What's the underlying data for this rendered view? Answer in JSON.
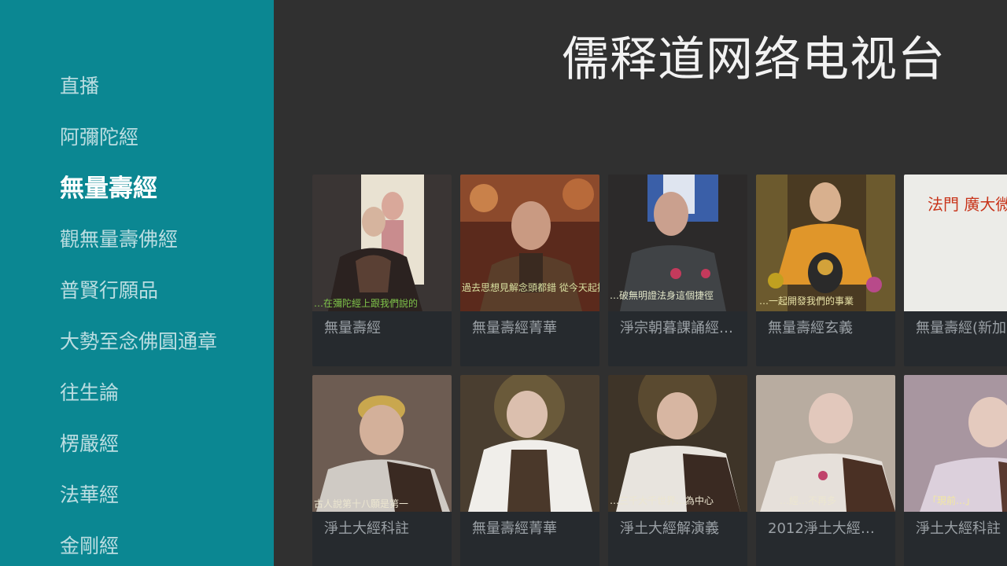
{
  "app_title": "儒释道网络电视台",
  "sidebar": {
    "items": [
      {
        "label": "直播"
      },
      {
        "label": "阿彌陀經"
      },
      {
        "label": "無量壽經",
        "selected": true
      },
      {
        "label": "觀無量壽佛經"
      },
      {
        "label": "普賢行願品"
      },
      {
        "label": "大勢至念佛圓通章"
      },
      {
        "label": "往生論"
      },
      {
        "label": "楞嚴經"
      },
      {
        "label": "法華經"
      },
      {
        "label": "金剛經"
      }
    ]
  },
  "rows": [
    {
      "cards": [
        {
          "title": "無量壽經",
          "subtitle_text": "…在彌陀經上跟我們說的"
        },
        {
          "title": "無量壽經菁華",
          "subtitle_text": "過去思想見解念頭都錯 從今天起把它換過來"
        },
        {
          "title": "淨宗朝暮課誦經…",
          "subtitle_text": "…破無明證法身這個捷徑"
        },
        {
          "title": "無量壽經玄義",
          "subtitle_text": "…一起開發我們的事業"
        },
        {
          "title": "無量壽經(新加…",
          "subtitle_text": "法門 廣大微妙 宣說如是"
        }
      ]
    },
    {
      "cards": [
        {
          "title": "淨土大經科註",
          "subtitle_text": "古人說第十八願是第一"
        },
        {
          "title": "無量壽經菁華",
          "subtitle_text": ""
        },
        {
          "title": "淨土大經解演義",
          "subtitle_text": "…三千大千世界…為中心"
        },
        {
          "title": "2012淨土大經科…",
          "subtitle_text": "…經…不再多"
        },
        {
          "title": "淨土大經科註",
          "subtitle_text": "「現前…」"
        }
      ]
    }
  ],
  "colors": {
    "sidebar": "#0b8792",
    "background": "#303030",
    "card": "#262a2e"
  }
}
